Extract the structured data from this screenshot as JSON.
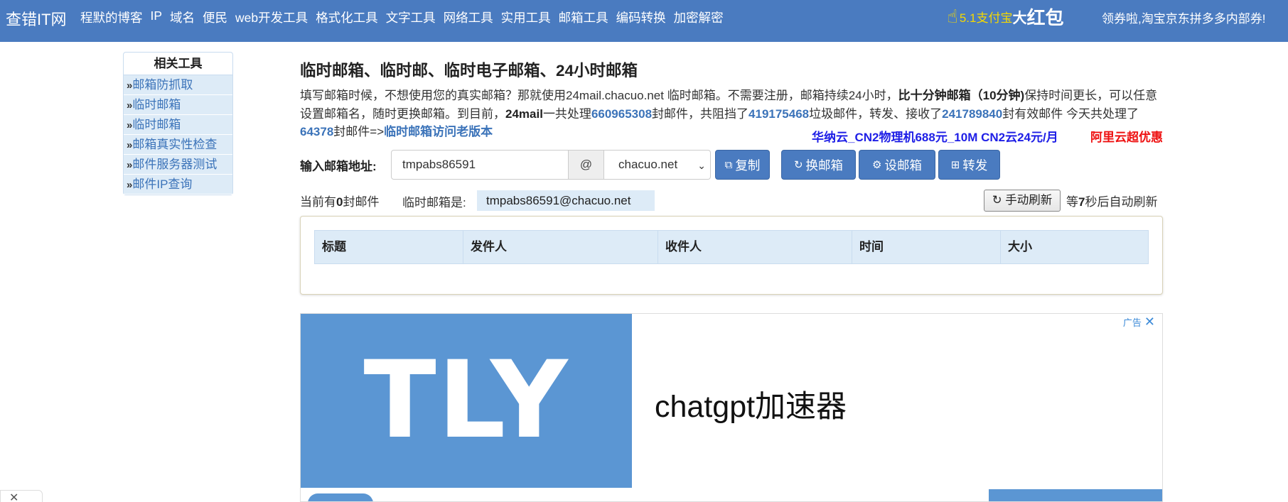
{
  "nav": {
    "brand": "查错IT网",
    "links": [
      "程默的博客",
      "IP",
      "域名",
      "便民",
      "web开发工具",
      "格式化工具",
      "文字工具",
      "网络工具",
      "实用工具",
      "邮箱工具",
      "编码转换",
      "加密解密"
    ],
    "promo_small": "5.1支付宝",
    "promo_mid": "大",
    "promo_big": "红包",
    "promo_right": "领券啦,淘宝京东拼多多内部券!"
  },
  "sidebar": {
    "heading": "相关工具",
    "arrow": "»",
    "items": [
      "邮箱防抓取",
      "临时邮箱",
      "临时邮箱",
      "邮箱真实性检查",
      "邮件服务器测试",
      "邮件IP查询"
    ]
  },
  "main": {
    "title": "临时邮箱、临时邮、临时电子邮箱、24小时邮箱",
    "desc": {
      "p1": "填写邮箱时候，不想使用您的真实邮箱？那就使用24mail.chacuo.net 临时邮箱。不需要注册，邮箱持续24小时，",
      "p1_bold": "比十分钟邮箱（10分钟)",
      "p2": "保持时间更长，可以任意设置邮箱名，随时更换邮箱。到目前，",
      "p2_bold": "24mail",
      "p3": "一共处理",
      "n1": "660965308",
      "p4": "封邮件，共阻挡了",
      "n2": "419175468",
      "p5": "垃圾邮件，转发、接收了",
      "n3": "241789840",
      "p6": "封有效邮件 今天共处理了",
      "n4": "64378",
      "p7": "封邮件=>",
      "old_link": "临时邮箱访问老版本"
    },
    "ad_huana": "华纳云_CN2物理机688元_10M CN2云24元/月",
    "ad_aliyun": "阿里云超优惠",
    "input_label": "输入邮箱地址:",
    "email_user": "tmpabs86591",
    "at_sign": "@",
    "domain_selected": "chacuo.net",
    "buttons": {
      "copy": "复制",
      "change": "换邮箱",
      "settings": "设邮箱",
      "forward": "转发"
    },
    "count_prefix": "当前有",
    "count_value": "0",
    "count_suffix": "封邮件",
    "tmp_label": "临时邮箱是:",
    "tmp_address": "tmpabs86591@chacuo.net",
    "refresh_label": "手动刷新",
    "auto_prefix": "等",
    "auto_seconds": "7",
    "auto_suffix": "秒后自动刷新",
    "table_headers": [
      "标题",
      "发件人",
      "收件人",
      "时间",
      "大小"
    ]
  },
  "ad": {
    "logo_text": "TLY",
    "headline": "chatgpt加速器",
    "tag": "广告",
    "close_glyph": "✕"
  },
  "corner_close": "✕",
  "colors": {
    "nav_bg": "#4a7bc0",
    "button_bg": "#4a7bc0",
    "link": "#3b73b9",
    "sidebar_item_bg": "#ddebf7",
    "ad_blue": "#5b96d3",
    "promo_yellow": "#f5d800",
    "ad_huana_color": "#1e1ee6",
    "ad_aliyun_color": "#ee1111"
  }
}
